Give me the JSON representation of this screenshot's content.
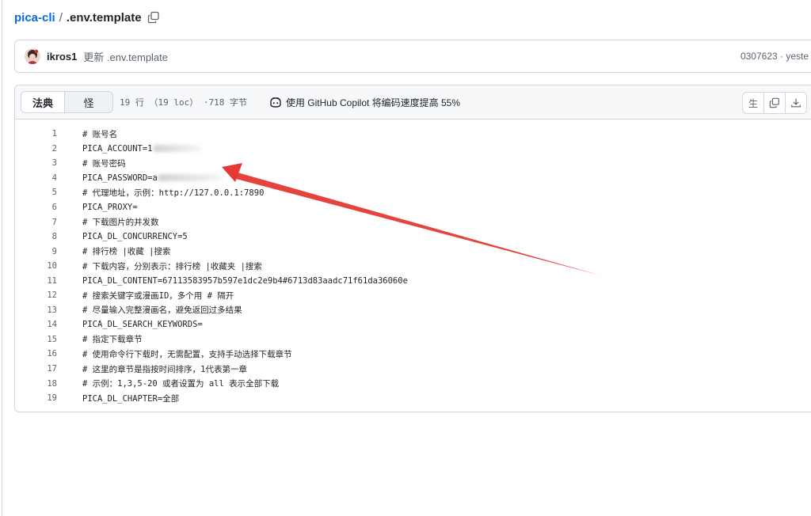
{
  "breadcrumb": {
    "repo": "pica-cli",
    "separator": "/",
    "file": ".env.template"
  },
  "commit": {
    "author": "ikros1",
    "message": "更新 .env.template",
    "meta": "0307623 · yeste"
  },
  "file_header": {
    "tabs": [
      {
        "label": "法典",
        "active": true
      },
      {
        "label": "怪",
        "active": false
      }
    ],
    "info": "19 行 （19 loc） ·718 字节",
    "copilot": "使用 GitHub Copilot 将编码速度提高 55%",
    "actions": {
      "raw_label": "生"
    }
  },
  "code_lines": [
    {
      "n": "1",
      "text": "# 账号名"
    },
    {
      "n": "2",
      "text": "PICA_ACCOUNT=1"
    },
    {
      "n": "3",
      "text": "# 账号密码"
    },
    {
      "n": "4",
      "text": "PICA_PASSWORD=a"
    },
    {
      "n": "5",
      "text": "# 代理地址，示例：http://127.0.0.1:7890"
    },
    {
      "n": "6",
      "text": "PICA_PROXY="
    },
    {
      "n": "7",
      "text": "# 下载图片的并发数"
    },
    {
      "n": "8",
      "text": "PICA_DL_CONCURRENCY=5"
    },
    {
      "n": "9",
      "text": "# 排行榜 |收藏 |搜索"
    },
    {
      "n": "10",
      "text": "# 下载内容，分别表示：排行榜 |收藏夹 |搜索"
    },
    {
      "n": "11",
      "text": "PICA_DL_CONTENT=67113583957b597e1dc2e9b4#6713d83aadc71f61da36060e"
    },
    {
      "n": "12",
      "text": "# 搜索关键字或漫画ID，多个用 # 隔开"
    },
    {
      "n": "13",
      "text": "# 尽量输入完整漫画名，避免返回过多结果"
    },
    {
      "n": "14",
      "text": "PICA_DL_SEARCH_KEYWORDS="
    },
    {
      "n": "15",
      "text": "# 指定下载章节"
    },
    {
      "n": "16",
      "text": "# 使用命令行下载时，无需配置，支持手动选择下载章节"
    },
    {
      "n": "17",
      "text": "# 这里的章节是指按时间排序，1代表第一章"
    },
    {
      "n": "18",
      "text": "# 示例：1,3,5-20 或者设置为 all 表示全部下载"
    },
    {
      "n": "19",
      "text": "PICA_DL_CHAPTER=全部"
    }
  ],
  "colors": {
    "link": "#0969da",
    "border": "#d0d7de",
    "header_bg": "#f6f8fa",
    "arrow": "#e53935"
  }
}
